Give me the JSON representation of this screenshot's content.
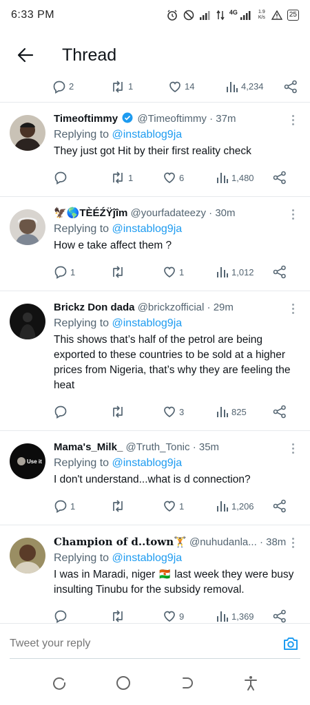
{
  "status_bar": {
    "time": "6:33 PM",
    "network": "4G",
    "speed": "1.9 K/s",
    "battery": "25"
  },
  "app_bar": {
    "title": "Thread"
  },
  "previous_tweet_actions": {
    "replies": "2",
    "retweets": "1",
    "likes": "14",
    "views": "4,234"
  },
  "tweets": [
    {
      "name": "Timeoftimmy",
      "verified": true,
      "handle": "@Timeoftimmy",
      "time": "· 37m",
      "replying_prefix": "Replying to ",
      "replying_to": "@instablog9ja",
      "text": "They just got Hit by their first reality check",
      "replies": "",
      "retweets": "1",
      "likes": "6",
      "views": "1,480"
    },
    {
      "name": "🦅🌎TÈÉŹŸĵîm",
      "handle": "@yourfadateezy",
      "time": "· 30m",
      "replying_prefix": "Replying to ",
      "replying_to": "@instablog9ja",
      "text": "How e take affect them ?",
      "replies": "1",
      "retweets": "",
      "likes": "1",
      "views": "1,012"
    },
    {
      "name": "Brickz Don dada",
      "handle": "@brickzofficial",
      "time": "· 29m",
      "replying_prefix": "Replying to ",
      "replying_to": "@instablog9ja",
      "text": "This shows that’s half of the petrol are being exported to these countries to be sold at a higher prices from Nigeria, that’s why they are feeling the heat",
      "replies": "",
      "retweets": "",
      "likes": "3",
      "views": "825"
    },
    {
      "name": "Mama's_Milk_",
      "handle": "@Truth_Tonic",
      "time": "· 35m",
      "replying_prefix": "Replying to ",
      "replying_to": "@instablog9ja",
      "text": "I don't understand...what is d connection?",
      "replies": "1",
      "retweets": "",
      "likes": "1",
      "views": "1,206",
      "avatar_text": "Use it"
    },
    {
      "name": "Champion of d..town🏋",
      "handle": "@nuhudanla...",
      "time": "· 38m",
      "replying_prefix": "Replying to ",
      "replying_to": "@instablog9ja",
      "text": "I was in Maradi, niger 🇳🇪 last week they were busy insulting Tinubu for the subsidy removal.",
      "replies": "",
      "retweets": "",
      "likes": "9",
      "views": "1,369"
    }
  ],
  "composer": {
    "placeholder": "Tweet your reply"
  },
  "icons": {
    "back": "arrow-left-icon",
    "reply": "speech-bubble-icon",
    "retweet": "retweet-icon",
    "like": "heart-icon",
    "views": "bar-chart-icon",
    "share": "share-icon",
    "camera": "camera-icon"
  },
  "colors": {
    "accent": "#1d9bf0",
    "muted": "#536471",
    "text": "#0f1419",
    "divider": "#e6e9ec"
  }
}
